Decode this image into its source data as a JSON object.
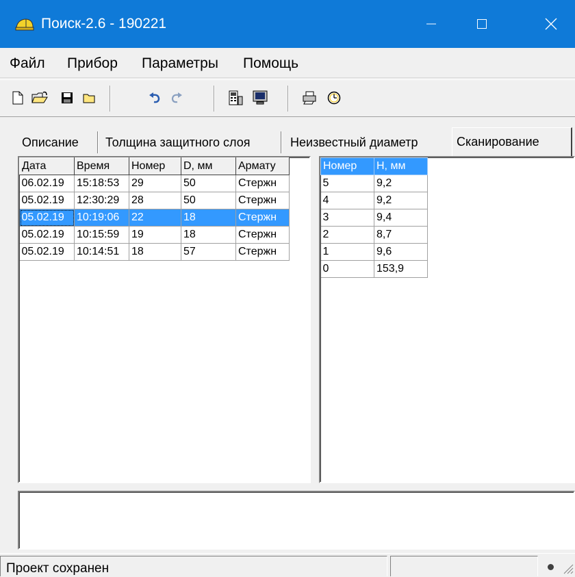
{
  "window": {
    "title": "Поиск-2.6 - 190221",
    "icon": "helmet-icon",
    "accent": "#0f7ad8"
  },
  "menu": [
    "Файл",
    "Прибор",
    "Параметры",
    "Помощь"
  ],
  "toolbar": {
    "buttons": [
      "new-file-icon",
      "open-folder-icon",
      "save-icon",
      "folder-icon",
      "undo-icon",
      "redo-icon",
      "device-icon",
      "monitor-icon",
      "print-icon",
      "clock-icon"
    ]
  },
  "tabs": [
    {
      "label": "Описание",
      "active": false
    },
    {
      "label": "Толщина защитного слоя",
      "active": false
    },
    {
      "label": "Неизвестный диаметр",
      "active": false
    },
    {
      "label": "Сканирование",
      "active": true
    }
  ],
  "left_table": {
    "headers": [
      "Дата",
      "Время",
      "Номер",
      "D, мм",
      "Армату"
    ],
    "rows": [
      [
        "06.02.19",
        "15:18:53",
        "29",
        "50",
        "Стержн"
      ],
      [
        "05.02.19",
        "12:30:29",
        "28",
        "50",
        "Стержн"
      ],
      [
        "05.02.19",
        "10:19:06",
        "22",
        "18",
        "Стержн"
      ],
      [
        "05.02.19",
        "10:15:59",
        "19",
        "18",
        "Стержн"
      ],
      [
        "05.02.19",
        "10:14:51",
        "18",
        "57",
        "Стержн"
      ]
    ],
    "selected_row": 2,
    "selection_color": "#3399ff"
  },
  "right_table": {
    "headers": [
      "Номер",
      "H, мм"
    ],
    "rows": [
      [
        "5",
        "9,2"
      ],
      [
        "4",
        "9,2"
      ],
      [
        "3",
        "9,4"
      ],
      [
        "2",
        "8,7"
      ],
      [
        "1",
        "9,6"
      ],
      [
        "0",
        "153,9"
      ]
    ]
  },
  "status": {
    "text": "Проект сохранен"
  }
}
